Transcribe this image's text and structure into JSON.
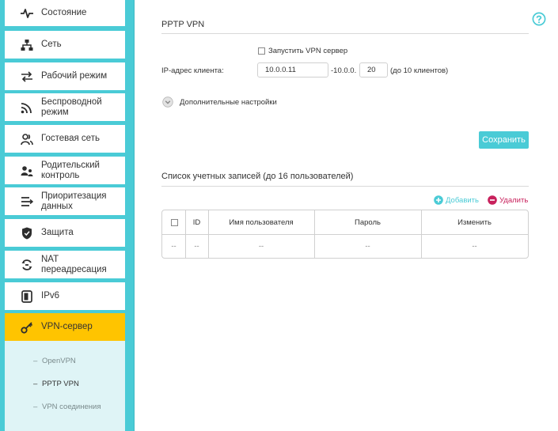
{
  "sidebar": {
    "items": [
      {
        "label": "Состояние",
        "icon": "status-icon"
      },
      {
        "label": "Сеть",
        "icon": "network-icon"
      },
      {
        "label": "Рабочий режим",
        "icon": "mode-icon"
      },
      {
        "label_lines": [
          "Беспроводной",
          "режим"
        ],
        "icon": "wireless-icon"
      },
      {
        "label": "Гостевая сеть",
        "icon": "guest-icon"
      },
      {
        "label_lines": [
          "Родительский",
          "контроль"
        ],
        "icon": "parental-icon"
      },
      {
        "label_lines": [
          "Приоритезация",
          "данных"
        ],
        "icon": "qos-icon"
      },
      {
        "label": "Защита",
        "icon": "shield-icon"
      },
      {
        "label": "NAT переадресация",
        "icon": "nat-icon"
      },
      {
        "label": "IPv6",
        "icon": "ipv6-icon"
      },
      {
        "label": "VPN-сервер",
        "icon": "vpn-icon",
        "active": true
      }
    ],
    "sub_items": [
      {
        "label": "OpenVPN"
      },
      {
        "label": "PPTP VPN",
        "active": true
      },
      {
        "label": "VPN соединения"
      }
    ]
  },
  "pptp": {
    "title": "PPTP VPN",
    "enable_label": "Запустить VPN сервер",
    "enabled": false,
    "client_ip_label": "IP-адрес клиента:",
    "ip_start": "10.0.0.11",
    "ip_separator": "-10.0.0.",
    "ip_end": "20",
    "ip_hint": "(до 10 клиентов)",
    "advanced_label": "Дополнительные настройки",
    "save_label": "Сохранить"
  },
  "accounts": {
    "title": "Список учетных записей (до 16 пользователей)",
    "add_label": "Добавить",
    "delete_label": "Удалить",
    "columns": [
      "ID",
      "Имя пользователя",
      "Пароль",
      "Изменить"
    ],
    "rows": [
      [
        "--",
        "--",
        "--",
        "--",
        "--"
      ]
    ]
  },
  "colors": {
    "accent": "#4acbd6",
    "active_nav": "#ffc400",
    "delete": "#c8215c"
  }
}
